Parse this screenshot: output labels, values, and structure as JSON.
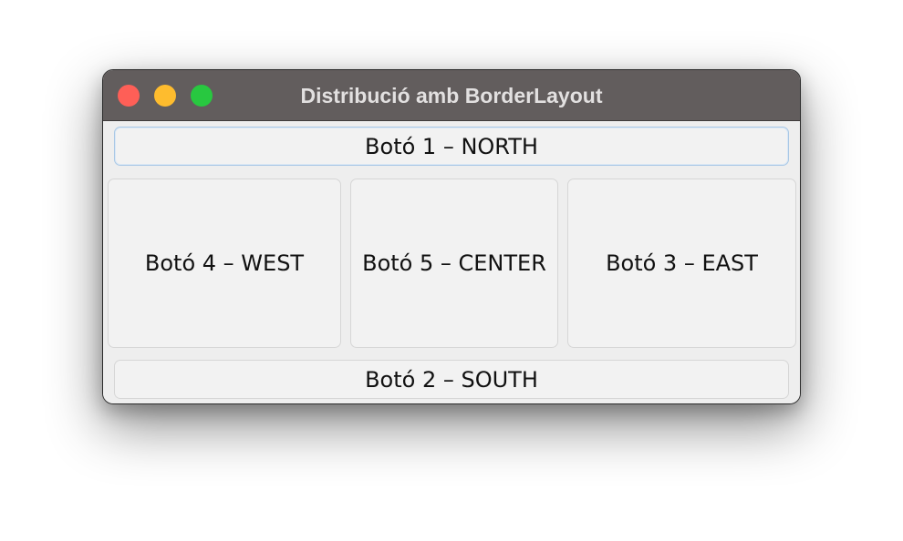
{
  "window": {
    "title": "Distribució amb BorderLayout"
  },
  "controls": {
    "close": "close-button",
    "minimize": "minimize-button",
    "maximize": "maximize-button"
  },
  "buttons": {
    "north": "Botó 1 – NORTH",
    "west": "Botó 4 – WEST",
    "center": "Botó 5 – CENTER",
    "east": "Botó 3 – EAST",
    "south": "Botó 2 – SOUTH"
  },
  "colors": {
    "titlebar": "#625d5d",
    "close": "#fe5f57",
    "minimize": "#febc2e",
    "maximize": "#28c840",
    "focus_border": "#a9c8e6"
  }
}
